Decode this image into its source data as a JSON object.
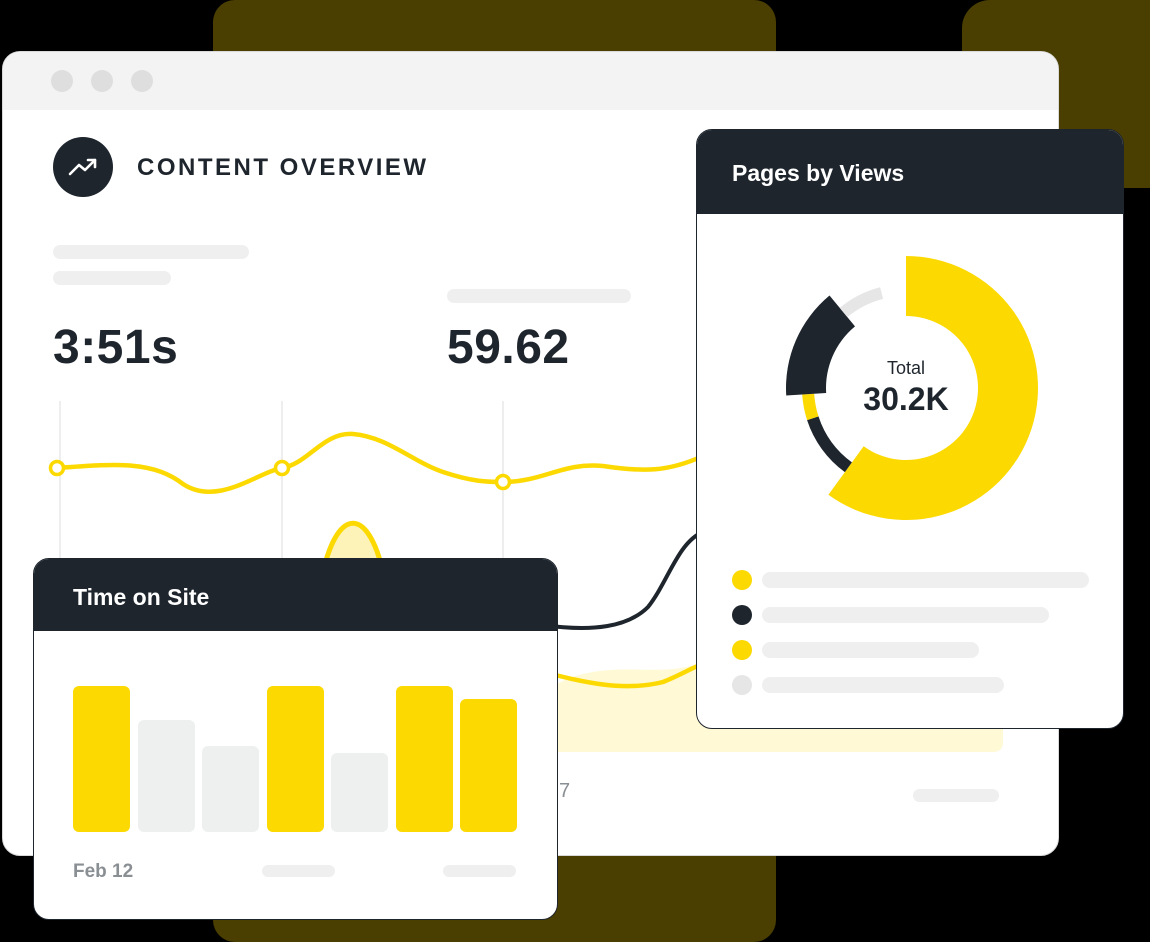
{
  "colors": {
    "accent_yellow": "#fcd900",
    "dark": "#1e252d",
    "light_gray": "#eeefef",
    "background_gold": "#4a3e00"
  },
  "overview": {
    "icon": "trend-up-icon",
    "title": "CONTENT OVERVIEW",
    "metric_1": "3:51s",
    "metric_2": "59.62",
    "partial_axis_label": "7"
  },
  "pages_by_views": {
    "title": "Pages by Views",
    "total_label": "Total",
    "total_value": "30.2K",
    "chart_data": {
      "type": "pie",
      "segments": [
        {
          "color": "#fcd900",
          "fraction": 0.6
        },
        {
          "color": "#1e252d",
          "fraction": 0.1
        },
        {
          "color": "#fcd900",
          "fraction": 0.04
        },
        {
          "color": "#1e252d",
          "fraction": 0.15
        },
        {
          "color": "#e6e6e6",
          "fraction": 0.07
        }
      ]
    },
    "legend": [
      {
        "color": "#fcd900"
      },
      {
        "color": "#1e252d"
      },
      {
        "color": "#fcd900"
      },
      {
        "color": "#e6e6e6"
      }
    ]
  },
  "time_on_site": {
    "title": "Time on Site",
    "x_label_first": "Feb 12",
    "chart_data": {
      "type": "bar",
      "values": [
        100,
        77,
        59,
        100,
        54,
        100,
        91
      ],
      "colors": [
        "#fcd900",
        "#eeefef",
        "#eeefef",
        "#fcd900",
        "#eeefef",
        "#fcd900",
        "#fcd900"
      ]
    }
  }
}
